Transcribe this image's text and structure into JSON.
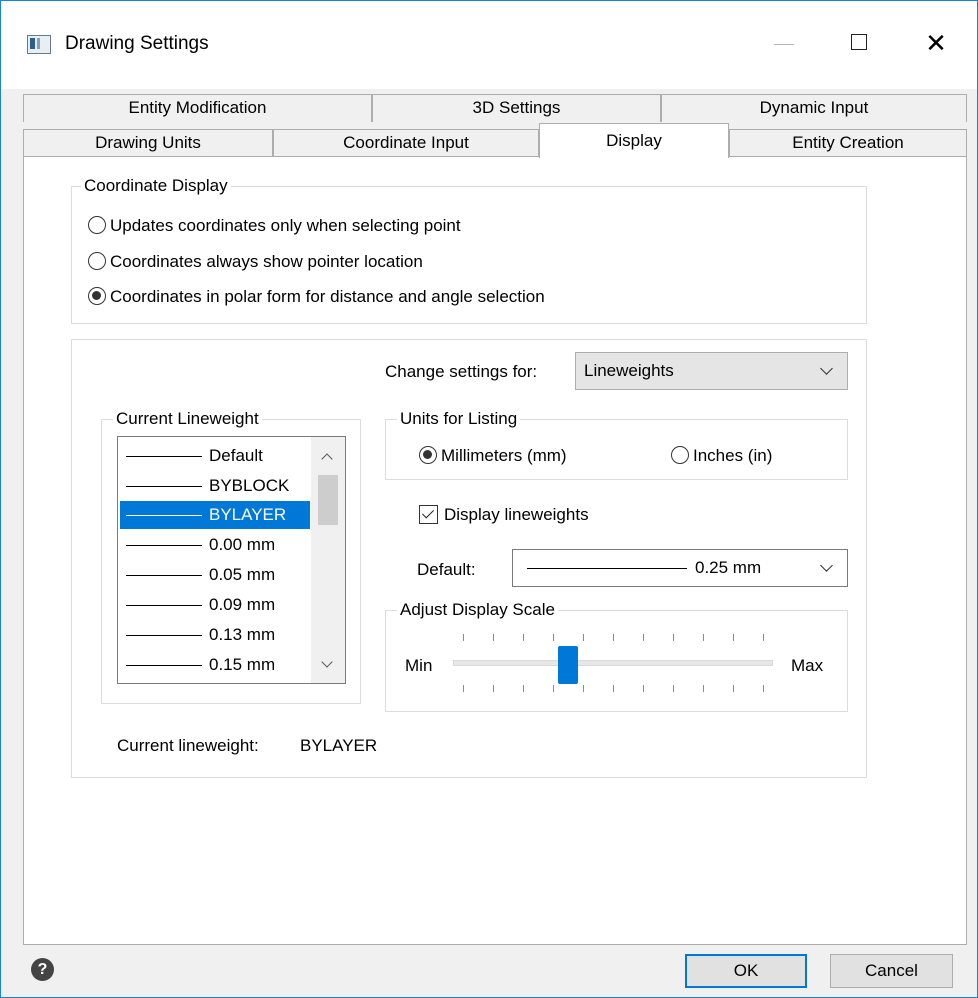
{
  "window": {
    "title": "Drawing Settings",
    "icon": "app-window-icon"
  },
  "tabs": {
    "row1": [
      "Entity Modification",
      "3D Settings",
      "Dynamic Input"
    ],
    "row2": [
      "Drawing Units",
      "Coordinate Input",
      "Display",
      "Entity Creation"
    ],
    "active": "Display"
  },
  "coordinate_display": {
    "label": "Coordinate Display",
    "options": [
      {
        "label": "Updates coordinates only when selecting point",
        "checked": false
      },
      {
        "label": "Coordinates always show pointer location",
        "checked": false
      },
      {
        "label": "Coordinates in polar form for distance and angle selection",
        "checked": true
      }
    ]
  },
  "change_settings": {
    "label": "Change settings for:",
    "value": "Lineweights"
  },
  "current_lineweight": {
    "label": "Current Lineweight",
    "items": [
      "Default",
      "BYBLOCK",
      "BYLAYER",
      "0.00 mm",
      "0.05 mm",
      "0.09 mm",
      "0.13 mm",
      "0.15 mm"
    ],
    "selected": "BYLAYER"
  },
  "units_for_listing": {
    "label": "Units for Listing",
    "options": [
      {
        "label": "Millimeters (mm)",
        "checked": true
      },
      {
        "label": "Inches (in)",
        "checked": false
      }
    ]
  },
  "display_lineweights": {
    "label": "Display lineweights",
    "checked": true
  },
  "default_lineweight": {
    "label": "Default:",
    "value": "0.25 mm"
  },
  "adjust_display_scale": {
    "label": "Adjust Display Scale",
    "min_label": "Min",
    "max_label": "Max",
    "position_fraction": 0.36
  },
  "status": {
    "label": "Current lineweight:",
    "value": "BYLAYER"
  },
  "buttons": {
    "ok": "OK",
    "cancel": "Cancel",
    "help": "?"
  },
  "colors": {
    "accent": "#0078d7",
    "window_border": "#1883d7"
  }
}
